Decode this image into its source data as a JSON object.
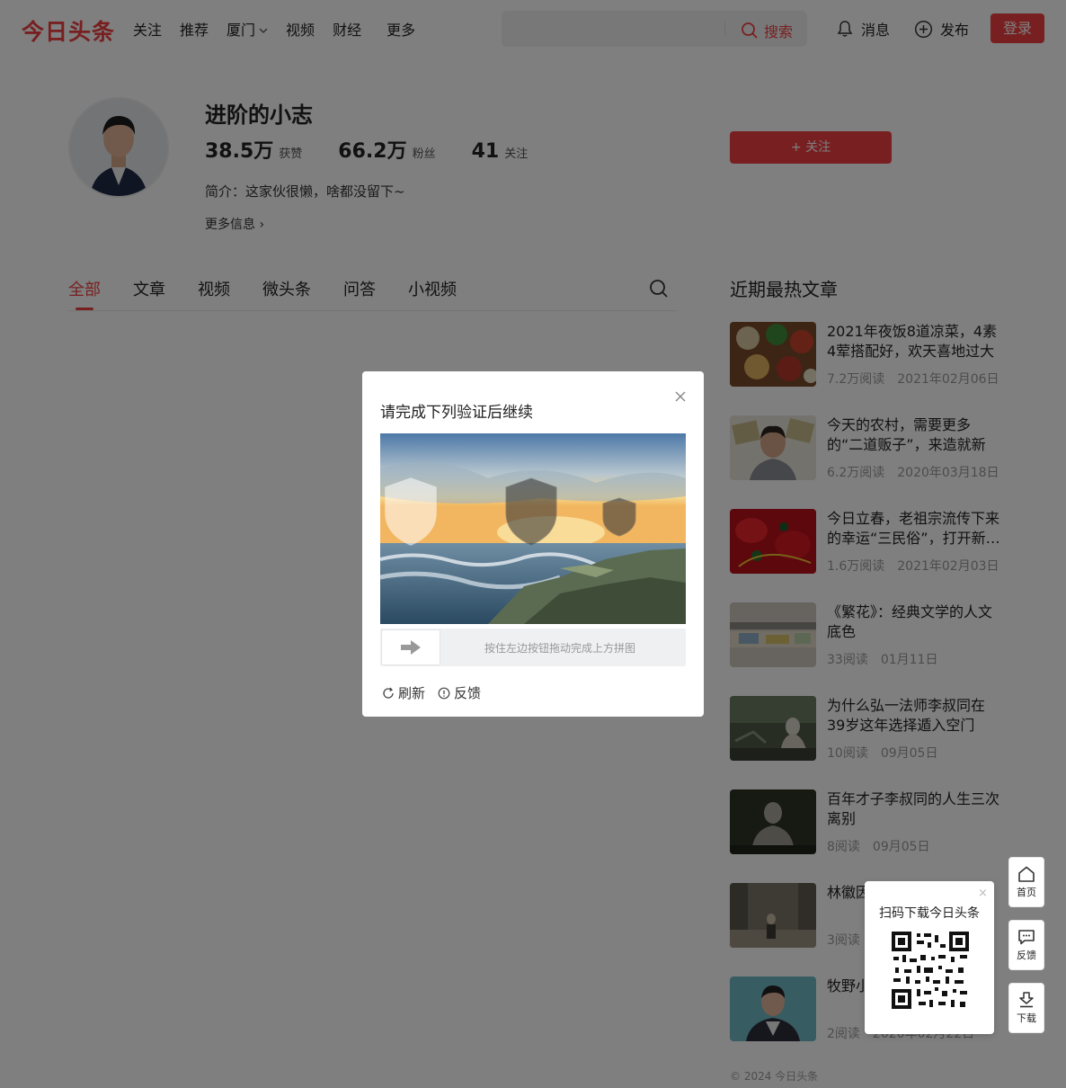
{
  "header": {
    "logo": "今日头条",
    "nav": [
      "关注",
      "推荐",
      "厦门",
      "视频",
      "财经",
      "更多"
    ],
    "search_button": "搜索",
    "messages": "消息",
    "publish": "发布",
    "login": "登录"
  },
  "profile": {
    "name": "进阶的小志",
    "stats": [
      {
        "value": "38.5万",
        "label": "获赞"
      },
      {
        "value": "66.2万",
        "label": "粉丝"
      },
      {
        "value": "41",
        "label": "关注"
      }
    ],
    "bio": "简介：这家伙很懒，啥都没留下~",
    "more_info": "更多信息 ›",
    "follow_button": "+ 关注"
  },
  "tabs": [
    "全部",
    "文章",
    "视频",
    "微头条",
    "问答",
    "小视频"
  ],
  "sidebar": {
    "title": "近期最热文章",
    "articles": [
      {
        "title": "2021年夜饭8道凉菜，4素4荤搭配好，欢天喜地过大年",
        "reads": "7.2万阅读",
        "date": "2021年02月06日"
      },
      {
        "title": "今天的农村，需要更多的“二道贩子”，来造就新一…",
        "reads": "6.2万阅读",
        "date": "2020年03月18日"
      },
      {
        "title": "今日立春，老祖宗流传下来的幸运“三民俗”，打开新…",
        "reads": "1.6万阅读",
        "date": "2021年02月03日"
      },
      {
        "title": "《繁花》：经典文学的人文底色",
        "reads": "33阅读",
        "date": "01月11日"
      },
      {
        "title": "为什么弘一法师李叔同在39岁这年选择遁入空门",
        "reads": "10阅读",
        "date": "09月05日"
      },
      {
        "title": "百年才子李叔同的人生三次离别",
        "reads": "8阅读",
        "date": "09月05日"
      },
      {
        "title": "林徽因…之久的…",
        "reads": "3阅读",
        "date": ""
      },
      {
        "title": "牧野小…",
        "reads": "2阅读",
        "date": "2020年02月22日"
      }
    ],
    "copyright": "© 2024 今日头条"
  },
  "captcha": {
    "title": "请完成下列验证后继续",
    "slider_hint": "按住左边按钮拖动完成上方拼图",
    "refresh": "刷新",
    "feedback": "反馈"
  },
  "qr_popup": {
    "title": "扫码下载今日头条",
    "close": "×"
  },
  "float_bar": {
    "home": "首页",
    "feedback": "反馈",
    "download": "下载"
  },
  "colors": {
    "brand_red": "#f04142",
    "overlay": "rgba(0,0,0,0.5)"
  }
}
